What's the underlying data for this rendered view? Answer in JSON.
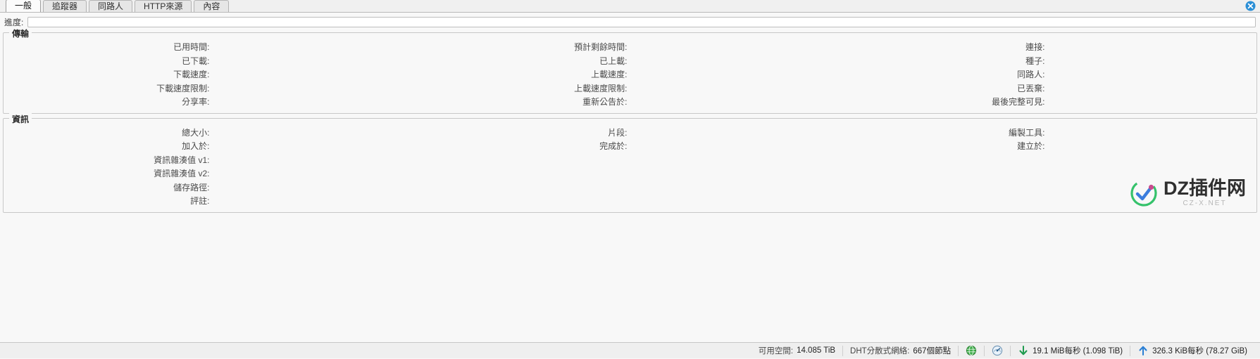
{
  "window": {
    "close_icon": "close-circle-icon"
  },
  "tabs": [
    {
      "label": "一般",
      "active": true
    },
    {
      "label": "追蹤器",
      "active": false
    },
    {
      "label": "同路人",
      "active": false
    },
    {
      "label": "HTTP來源",
      "active": false
    },
    {
      "label": "內容",
      "active": false
    }
  ],
  "progress": {
    "label": "進度:",
    "percent": 0,
    "value_text": ""
  },
  "transfer": {
    "legend": "傳輸",
    "columns": [
      [
        {
          "label": "已用時間:",
          "value": ""
        },
        {
          "label": "已下載:",
          "value": ""
        },
        {
          "label": "下載速度:",
          "value": ""
        },
        {
          "label": "下載速度限制:",
          "value": ""
        },
        {
          "label": "分享率:",
          "value": ""
        }
      ],
      [
        {
          "label": "預計剩餘時間:",
          "value": ""
        },
        {
          "label": "已上載:",
          "value": ""
        },
        {
          "label": "上載速度:",
          "value": ""
        },
        {
          "label": "上載速度限制:",
          "value": ""
        },
        {
          "label": "重新公告於:",
          "value": ""
        }
      ],
      [
        {
          "label": "連接:",
          "value": ""
        },
        {
          "label": "種子:",
          "value": ""
        },
        {
          "label": "同路人:",
          "value": ""
        },
        {
          "label": "已丟棄:",
          "value": ""
        },
        {
          "label": "最後完整可見:",
          "value": ""
        }
      ]
    ]
  },
  "information": {
    "legend": "資訊",
    "columns": [
      [
        {
          "label": "總大小:",
          "value": ""
        },
        {
          "label": "加入於:",
          "value": ""
        },
        {
          "label": "資訊雜湊值 v1:",
          "value": ""
        },
        {
          "label": "資訊雜湊值 v2:",
          "value": ""
        },
        {
          "label": "儲存路徑:",
          "value": ""
        },
        {
          "label": "評註:",
          "value": ""
        }
      ],
      [
        {
          "label": "片段:",
          "value": ""
        },
        {
          "label": "完成於:",
          "value": ""
        },
        {
          "label": "",
          "value": ""
        },
        {
          "label": "",
          "value": ""
        },
        {
          "label": "",
          "value": ""
        },
        {
          "label": "",
          "value": ""
        }
      ],
      [
        {
          "label": "編製工具:",
          "value": ""
        },
        {
          "label": "建立於:",
          "value": ""
        },
        {
          "label": "",
          "value": ""
        },
        {
          "label": "",
          "value": ""
        },
        {
          "label": "",
          "value": ""
        },
        {
          "label": "",
          "value": ""
        }
      ]
    ]
  },
  "watermark": {
    "title": "DZ插件网",
    "subtitle": "CZ-X.NET",
    "mark_icon": "checkmark-circle-logo"
  },
  "statusbar": {
    "free_space_label": "可用空間:",
    "free_space_value": "14.085 TiB",
    "dht_label": "DHT分散式網絡:",
    "dht_value": "667個節點",
    "connection_icon": "globe-green-icon",
    "alt_speed_icon": "speedometer-icon",
    "download_icon": "download-arrow-icon",
    "download_text": "19.1 MiB每秒 (1.098 TiB)",
    "upload_icon": "upload-arrow-icon",
    "upload_text": "326.3 KiB每秒 (78.27 GiB)"
  },
  "colors": {
    "accent": "#3c8adf",
    "download": "#1f9b4f",
    "upload": "#2a7fd4",
    "panel": "#f8f8f8",
    "statusbar": "#efefef"
  }
}
